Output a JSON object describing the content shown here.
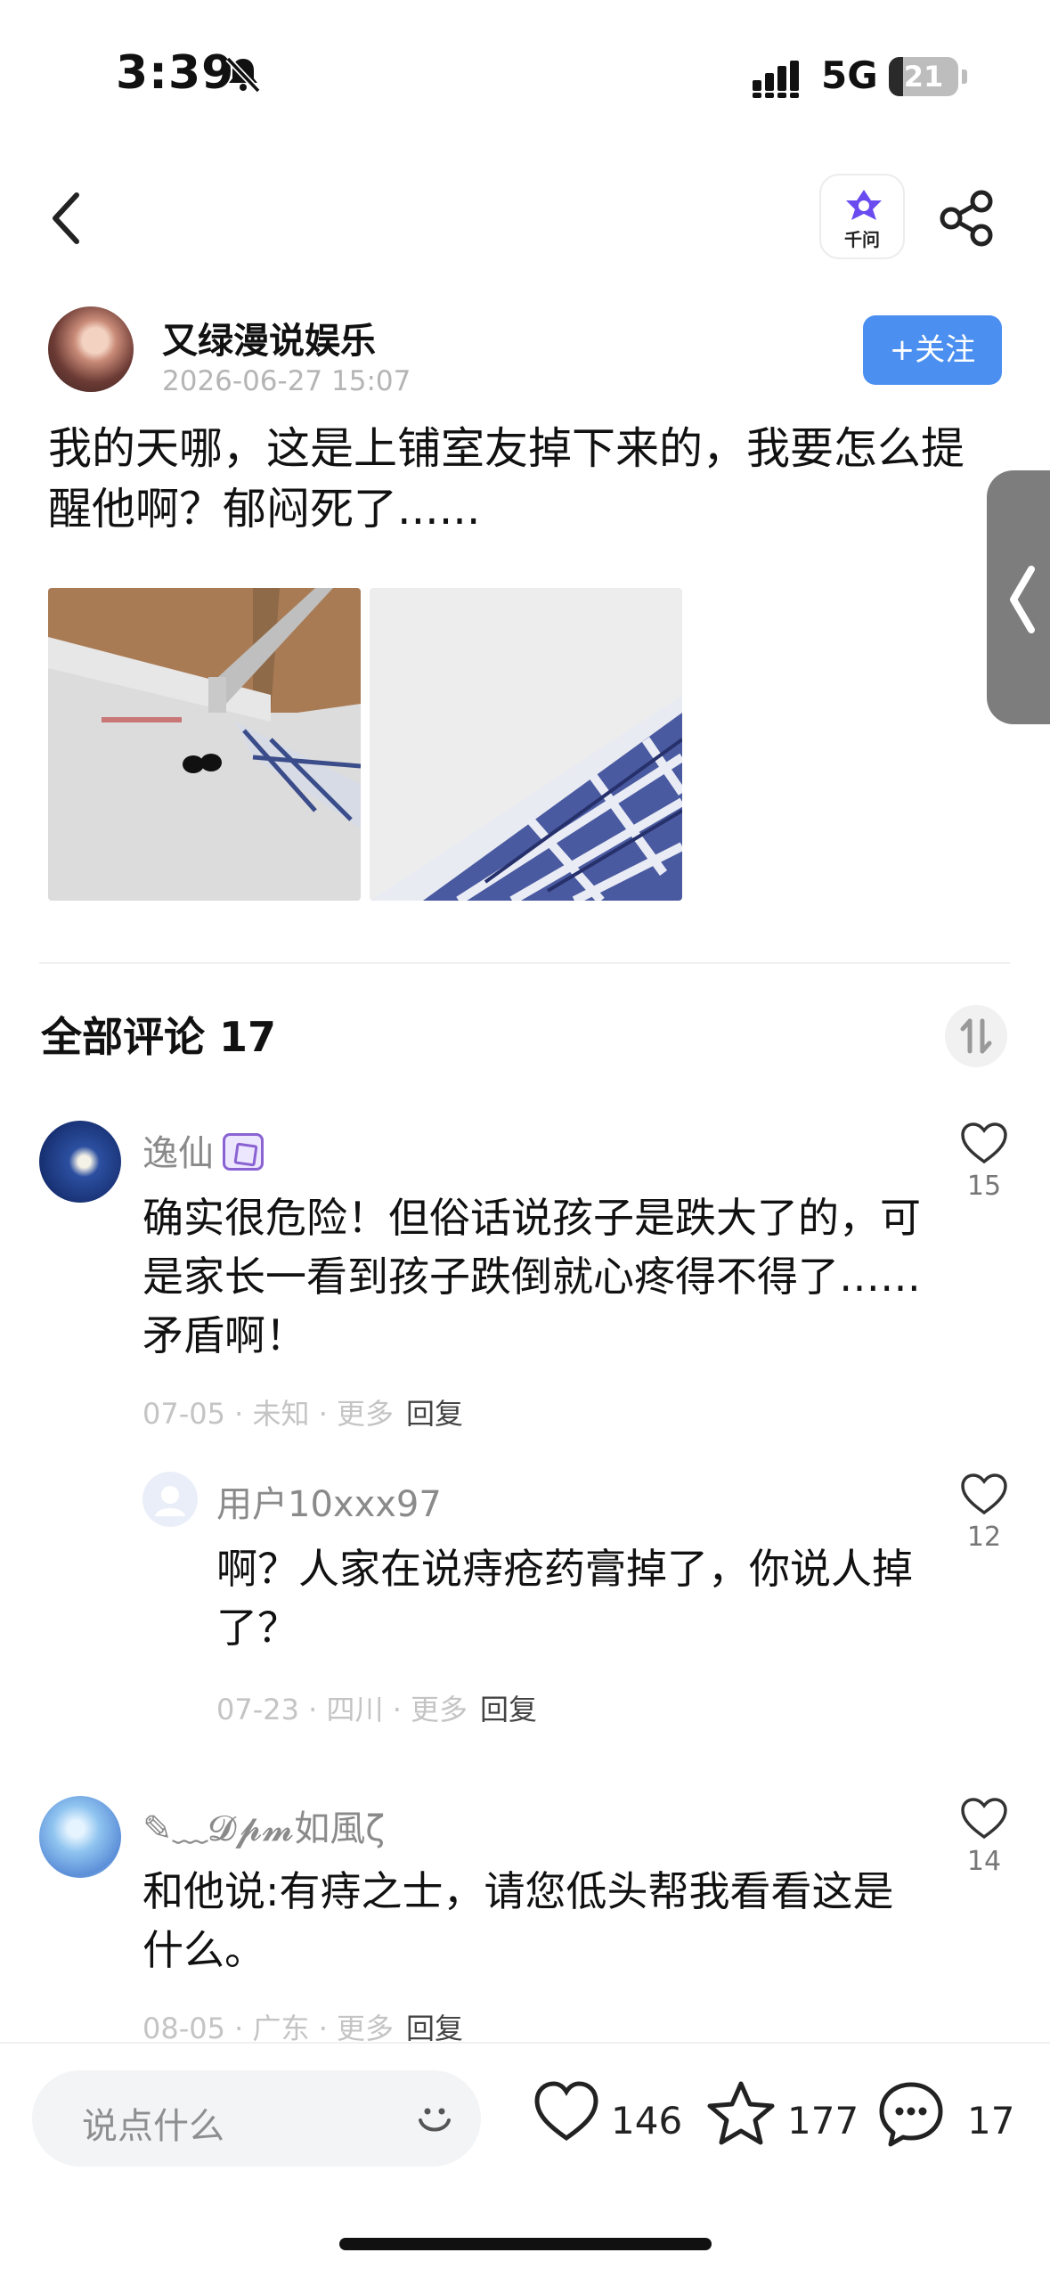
{
  "status_bar": {
    "time": "3:39",
    "network": "5G",
    "battery": "21",
    "battery_level": 0.21
  },
  "nav": {
    "assistant_label": "千问"
  },
  "post": {
    "author": "又绿漫说娱乐",
    "timestamp": "2026-06-27 15:07",
    "follow_label": "+关注",
    "text": "我的天哪，这是上铺室友掉下来的，我要怎么提醒他啊？郁闷死了......"
  },
  "comments_header": "全部评论 17",
  "comments": [
    {
      "name": "逸仙",
      "text": "确实很危险！但俗话说孩子是跌大了的，可是家长一看到孩子跌倒就心疼得不得了……矛盾啊！",
      "date": "07-05",
      "location": "未知",
      "more": "更多",
      "reply": "回复",
      "likes": "15"
    },
    {
      "name": "用户10xxx97",
      "text": "啊？人家在说痔疮药膏掉了，你说人掉了？",
      "date": "07-23",
      "location": "四川",
      "more": "更多",
      "reply": "回复",
      "likes": "12"
    },
    {
      "name": "✎﹏𝓓𝓹𝓶如風ζ",
      "text": "和他说:有痔之士，请您低头帮我看看这是什么。",
      "date": "08-05",
      "location": "广东",
      "more": "更多",
      "reply": "回复",
      "likes": "14"
    }
  ],
  "bottom_bar": {
    "input_placeholder": "说点什么",
    "likes": "146",
    "favorites": "177",
    "comments": "17"
  },
  "colors": {
    "accent": "#4b8ff0",
    "muted": "#c4c4c4"
  }
}
